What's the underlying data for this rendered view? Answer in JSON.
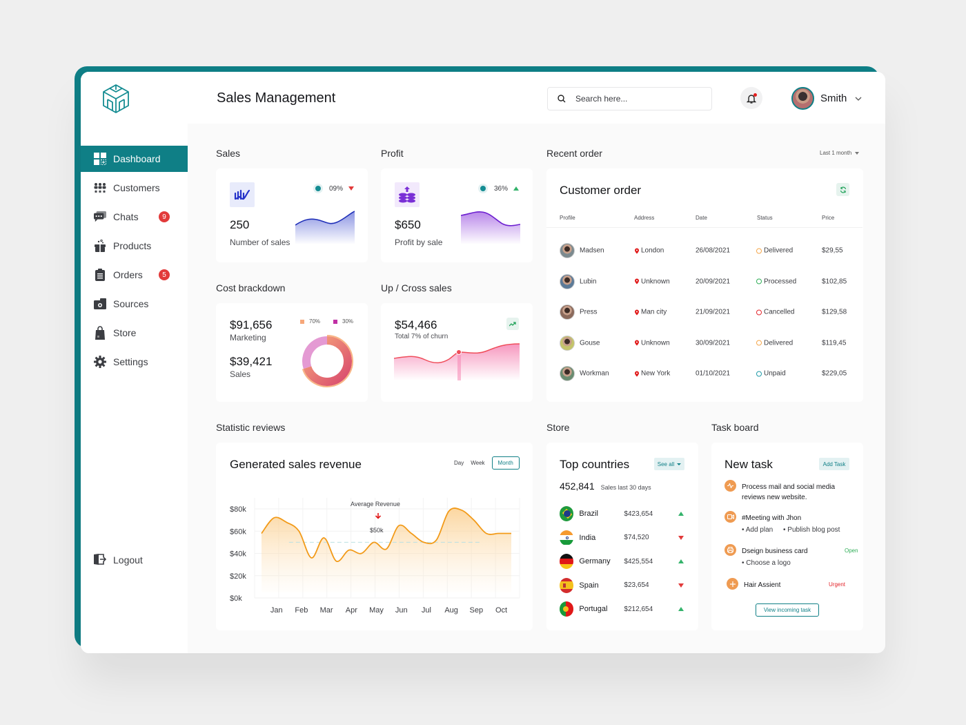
{
  "app": {
    "title": "Sales Management"
  },
  "colors": {
    "accent": "#0f7f86",
    "danger": "#e23a3a",
    "success": "#34b36b",
    "orange": "#f5a024"
  },
  "header": {
    "search_placeholder": "Search here...",
    "user_name": "Smith",
    "notification_unread": true
  },
  "sidebar": {
    "items": [
      {
        "label": "Dashboard",
        "icon": "dashboard-icon",
        "active": true
      },
      {
        "label": "Customers",
        "icon": "customers-icon"
      },
      {
        "label": "Chats",
        "icon": "chats-icon",
        "badge": "9"
      },
      {
        "label": "Products",
        "icon": "products-icon"
      },
      {
        "label": "Orders",
        "icon": "orders-icon",
        "badge": "5"
      },
      {
        "label": "Sources",
        "icon": "sources-icon"
      },
      {
        "label": "Store",
        "icon": "store-icon"
      },
      {
        "label": "Settings",
        "icon": "settings-icon"
      }
    ],
    "logout_label": "Logout"
  },
  "sales": {
    "section": "Sales",
    "value": "250",
    "label": "Number of sales",
    "change": "09%",
    "trend": "down"
  },
  "profit": {
    "section": "Profit",
    "value": "$650",
    "label": "Profit by sale",
    "change": "36%",
    "trend": "up"
  },
  "cost": {
    "section": "Cost brackdown",
    "marketing_value": "$91,656",
    "marketing_label": "Marketing",
    "sales_value": "$39,421",
    "sales_label": "Sales",
    "legend": [
      {
        "label": "70%",
        "color": "#f6a77a"
      },
      {
        "label": "30%",
        "color": "#c02fa4"
      }
    ],
    "share": [
      70,
      30
    ]
  },
  "cross": {
    "section": "Up / Cross sales",
    "value": "$54,466",
    "label": "Total 7% of churn"
  },
  "orders": {
    "section": "Recent order",
    "filter": "Last 1 month",
    "title": "Customer order",
    "columns": [
      "Profile",
      "Address",
      "Date",
      "Status",
      "Price"
    ],
    "rows": [
      {
        "name": "Madsen",
        "address": "London",
        "date": "26/08/2021",
        "status": "Delivered",
        "price": "$29,55"
      },
      {
        "name": "Lubin",
        "address": "Unknown",
        "date": "20/09/2021",
        "status": "Processed",
        "price": "$102,85"
      },
      {
        "name": "Press",
        "address": "Man city",
        "date": "21/09/2021",
        "status": "Cancelled",
        "price": "$129,58"
      },
      {
        "name": "Gouse",
        "address": "Unknown",
        "date": "30/09/2021",
        "status": "Delivered",
        "price": "$119,45"
      },
      {
        "name": "Workman",
        "address": "New York",
        "date": "01/10/2021",
        "status": "Unpaid",
        "price": "$229,05"
      }
    ]
  },
  "revenue": {
    "section": "Statistic reviews",
    "title": "Generated sales revenue",
    "ranges": [
      "Day",
      "Week",
      "Month"
    ],
    "active_range": "Month",
    "annotation_label": "Average Revenue",
    "annotation_value": "$50k"
  },
  "chart_data": {
    "type": "area",
    "title": "Generated sales revenue",
    "categories": [
      "Jan",
      "Feb",
      "Mar",
      "Apr",
      "May",
      "Jun",
      "Jul",
      "Aug",
      "Sep",
      "Oct"
    ],
    "x": [
      0,
      0.5,
      1,
      1.5,
      2,
      2.5,
      3,
      3.5,
      4,
      4.5,
      5,
      5.5,
      6,
      6.5,
      7,
      7.5,
      8,
      8.5,
      9,
      9.5,
      10
    ],
    "values": [
      58,
      72,
      68,
      60,
      36,
      54,
      33,
      43,
      40,
      50,
      44,
      65,
      58,
      50,
      52,
      78,
      79,
      70,
      58,
      58,
      58
    ],
    "y_ticks": [
      "$0k",
      "$20k",
      "$40k",
      "$60k",
      "$80k"
    ],
    "ylim": [
      0,
      85
    ],
    "reference_line": 50,
    "grid": true,
    "unit": "$k"
  },
  "store": {
    "section": "Store",
    "title": "Top countries",
    "see_all": "See all",
    "total": "452,841",
    "total_label": "Sales last 30 days",
    "countries": [
      {
        "name": "Brazil",
        "value": "$423,654",
        "trend": "up"
      },
      {
        "name": "India",
        "value": "$74,520",
        "trend": "down"
      },
      {
        "name": "Germany",
        "value": "$425,554",
        "trend": "up"
      },
      {
        "name": "Spain",
        "value": "$23,654",
        "trend": "down"
      },
      {
        "name": "Portugal",
        "value": "$212,654",
        "trend": "up"
      }
    ]
  },
  "tasks": {
    "section": "Task board",
    "title": "New task",
    "add_label": "Add Task",
    "items": [
      {
        "title": "Process mail and social media reviews new website.",
        "icon": "activity-icon"
      },
      {
        "title": "#Meeting with Jhon",
        "subs": [
          "Add plan",
          "Publish blog post"
        ],
        "icon": "video-icon"
      },
      {
        "title": "Dseign business card",
        "subs": [
          "Choose a logo"
        ],
        "tag": "Open",
        "icon": "printer-icon"
      },
      {
        "title": "Hair Assient",
        "tag": "Urgent",
        "icon": "plus-icon"
      }
    ],
    "view_label": "View incoming task"
  }
}
